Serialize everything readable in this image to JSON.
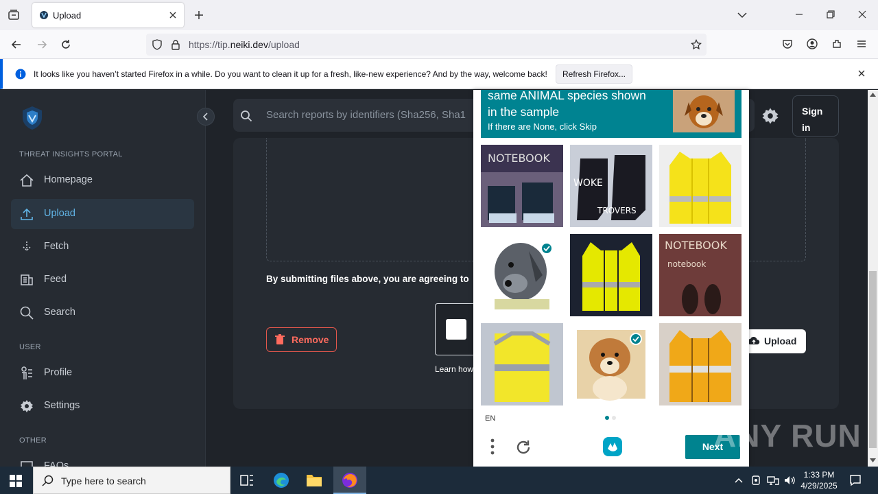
{
  "browser": {
    "tab_title": "Upload",
    "url_prefix": "https://tip.",
    "url_domain": "neiki.dev",
    "url_path": "/upload",
    "notification_text": "It looks like you haven’t started Firefox in a while. Do you want to clean it up for a fresh, like-new experience? And by the way, welcome back!",
    "notification_button": "Refresh Firefox..."
  },
  "sidebar": {
    "section_portal": "THREAT INSIGHTS PORTAL",
    "section_user": "USER",
    "section_other": "OTHER",
    "items": [
      {
        "label": "Homepage",
        "icon": "home-icon"
      },
      {
        "label": "Upload",
        "icon": "upload-icon",
        "active": true
      },
      {
        "label": "Fetch",
        "icon": "fetch-icon"
      },
      {
        "label": "Feed",
        "icon": "feed-icon"
      },
      {
        "label": "Search",
        "icon": "search-icon"
      },
      {
        "label": "Profile",
        "icon": "profile-icon"
      },
      {
        "label": "Settings",
        "icon": "gear-icon"
      },
      {
        "label": "FAQs",
        "icon": "faq-icon"
      }
    ]
  },
  "header": {
    "search_placeholder": "Search reports by identifiers (Sha256, Sha1",
    "signin_line1": "Sign",
    "signin_line2": "in"
  },
  "main": {
    "agree_text": "By submitting files above, you are agreeing to",
    "remove_label": "Remove",
    "upload_label": "Upload",
    "learn_text": "Learn how"
  },
  "captcha": {
    "prompt_line1": "same ANIMAL species shown",
    "prompt_line2": "in the sample",
    "prompt_line3": "If there are None, click Skip",
    "language": "EN",
    "next_label": "Next",
    "page_dots": [
      true,
      false
    ],
    "tiles": [
      {
        "content": "boots-notebook",
        "selected": false
      },
      {
        "content": "boots-text",
        "selected": false
      },
      {
        "content": "yellow-vest",
        "selected": false
      },
      {
        "content": "dog-grey",
        "selected": true
      },
      {
        "content": "yellow-vest-dark",
        "selected": false
      },
      {
        "content": "notebook-shoes",
        "selected": false
      },
      {
        "content": "yellow-vest-folded",
        "selected": false
      },
      {
        "content": "dog-brown",
        "selected": true
      },
      {
        "content": "orange-vest",
        "selected": false
      }
    ]
  },
  "watermark": "ANY RUN",
  "taskbar": {
    "search_placeholder": "Type here to search",
    "time": "1:33 PM",
    "date": "4/29/2025"
  },
  "colors": {
    "accent": "#00838f",
    "sidebar_active_text": "#62b6e8",
    "danger": "#e2574c"
  }
}
